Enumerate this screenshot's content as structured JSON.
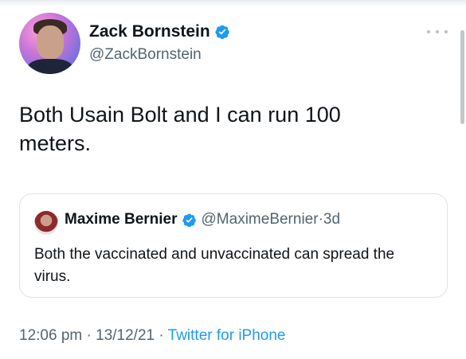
{
  "author": {
    "display_name": "Zack Bornstein",
    "handle": "@ZackBornstein",
    "verified": true
  },
  "tweet": {
    "text": "Both Usain Bolt and I can run 100 meters."
  },
  "quoted_tweet": {
    "display_name": "Maxime Bernier",
    "handle": "@MaximeBernier",
    "separator": " · ",
    "age": "3d",
    "text": "Both the vaccinated and unvaccinated can spread the virus.",
    "verified": true
  },
  "meta": {
    "time": "12:06 pm",
    "dot": " · ",
    "date": "13/12/21",
    "source": "Twitter for iPhone"
  },
  "colors": {
    "verified": "#1d9bf0",
    "secondary_text": "#536471",
    "link": "#1d9bf0"
  }
}
